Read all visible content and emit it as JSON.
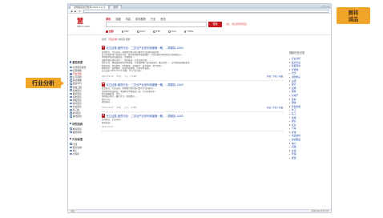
{
  "badge": {
    "line1": "赛将",
    "line2": "诚品"
  },
  "callout": "行业分析",
  "window": {
    "tab_title": "慧博投研资讯终端 2021 V1.12",
    "tab2": "慧博",
    "url": ""
  },
  "site": {
    "logo_mark": "慧",
    "logo_accent": "博",
    "logo_sub": "HIBOR QUERY",
    "tabs": [
      "资讯",
      "标题",
      "内容",
      "机构推荐",
      "行业",
      "资讯"
    ],
    "search_button": "搜索",
    "search_hint": "(如：通过搜索按钮)",
    "filters": [
      "全部",
      "PDF",
      "DOC",
      "PPT",
      "XLS",
      "HTML"
    ]
  },
  "sidebar": {
    "title": "报告类型",
    "items": [
      {
        "label": "全部研究报告",
        "selected": false
      },
      {
        "label": "宏观策略",
        "selected": false
      },
      {
        "label": "行业分析",
        "selected": true
      },
      {
        "label": "公司调研",
        "selected": false
      },
      {
        "label": "投资策略",
        "selected": false
      },
      {
        "label": "晨会早刊",
        "selected": false
      },
      {
        "label": "金融工程",
        "selected": false
      },
      {
        "label": "债券研究",
        "selected": false
      },
      {
        "label": "期货研究",
        "selected": false
      },
      {
        "label": "基金研究",
        "selected": false
      },
      {
        "label": "港股研究",
        "selected": false
      },
      {
        "label": "海外研究",
        "selected": false
      },
      {
        "label": "外资研究",
        "selected": false
      },
      {
        "label": "新三板",
        "selected": false
      },
      {
        "label": "IPO研究",
        "selected": false
      },
      {
        "label": "其他报告",
        "selected": false
      }
    ],
    "group2_title": "研究机构",
    "group2_items": [
      "券商研究",
      "其他机构"
    ],
    "group3_title": "行业标签",
    "group3_items": [
      "全部",
      "医药生物",
      "电子",
      "计算机"
    ]
  },
  "crumb": {
    "prefix": "搜索：",
    "keyword": "行业分析",
    "suffix": " 共找到 报告"
  },
  "results": [
    {
      "title": "长江证券-医药行业：二次元产业系列深度第一期，...周报告-1004",
      "lines": [
        "投资要点：行业分析，本期我们将分析对医药行业的影响和趋势…",
        "长江证券医药行业报告显示，医药板块整体表现强劲，行业分析表明创新药企业研发投入…",
        "本周医药板块涨幅居前，生物医药…",
        "国家医保局发布关于…，中药板块…行业分析专题…",
        "我们认为，随着政策环境不断改善，行业整体景气度持续回升，重点推荐…，公司具备长期成长性…",
        "相关标的：恒瑞医药、药明康德、迈瑞医疗、爱尔眼科、智飞生物…",
        "风险提示：政策风险、研发不及预期、市场竞争加剧…",
        "长江证券 2021-04-10 页数：31 行业分析…"
      ],
      "date": "2021-04-10",
      "pages": "31页",
      "size": "大小：2.54M",
      "actions": "预览 | 下载 | 收藏"
    },
    {
      "title": "长江证券-医药行业：二次元产业系列深度第一期，...周报告-1003",
      "lines": [
        "投资要点：行业分析，本期我们将分析对医药行业的影响…",
        "本周医药板块表现：本周医药生物板块上涨…行业分析显示…",
        "医疗器械板块，关注…",
        "本周核心观点…重点关注，继续看好…",
        "我们认为…",
        "相关标的…"
      ],
      "date": "2021-04-03",
      "pages": "28页",
      "size": "大小：1.98M",
      "actions": "预览 | 下载 | 收藏"
    },
    {
      "title": "长江证券-医药行业：二次元产业系列深度第一期，...周报告-1002",
      "lines": [
        "投资要点：行业分析…",
        "医药板块…"
      ],
      "date": "2021-03-27",
      "pages": "",
      "size": "",
      "actions": ""
    }
  ],
  "right": {
    "title": "搜索历史记录",
    "items": [
      "行业分析",
      "医药行业",
      "新能源车",
      "半导体",
      "光伏",
      "消费电子",
      "白酒",
      "银行",
      "证券",
      "保险",
      "房地产",
      "建材",
      "钢铁",
      "有色金属",
      "化工",
      "军工",
      "传媒",
      "通信",
      "农业",
      "汽车",
      "家电",
      "食品饮料",
      "纺织服装",
      "电力",
      "机械",
      "交运",
      "环保",
      "旅游"
    ]
  },
  "status": {
    "left": "完成",
    "right": "2021-04-10 11:32"
  }
}
